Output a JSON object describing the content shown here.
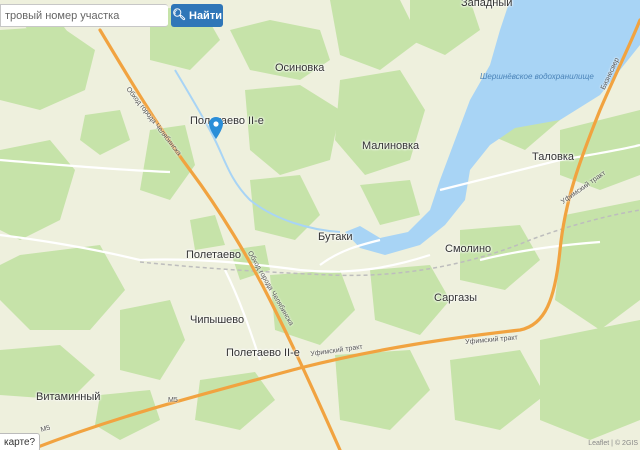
{
  "search": {
    "placeholder": "Кадастровый номер участка",
    "visible_text": "тровый номер участка",
    "button_label": "Найти",
    "button_icon": "search-icon"
  },
  "map_link": {
    "label": "карте?"
  },
  "attribution": {
    "text": "Leaflet | © 2GIS"
  },
  "colors": {
    "background": "#eef0dd",
    "forest": "#c6e3a9",
    "water": "#a8d4f5",
    "highway": "#f1a340",
    "road": "#ffffff",
    "button": "#2f76b8",
    "marker": "#2a8ed8"
  },
  "places": {
    "zapadny": "Западный",
    "osinovka": "Осиновка",
    "poletaevo2_top": "Полетаево II-е",
    "malinovka": "Малиновка",
    "talovka": "Таловка",
    "butaki": "Бутаки",
    "smolino": "Смолино",
    "poletaevo": "Полетаево",
    "sargazy": "Саргазы",
    "chipyshevo": "Чипышево",
    "poletaevo2_bottom": "Полетаево II-е",
    "vitaminny": "Витаминный"
  },
  "water_labels": {
    "reservoir": "Шершнёвское водохранилище"
  },
  "roads": {
    "obkhod_top": "Обход города Челябинска",
    "obkhod_mid": "Обход города Челябинска",
    "ufimsky_bottom": "Уфимский тракт",
    "ufimsky_right_a": "Уфимский тракт",
    "ufimsky_right_b": "Уфимский тракт",
    "m5": "М5",
    "m5_left": "М5",
    "bypass_ne": "Бизнесвер"
  },
  "marker": {
    "icon": "map-pin-icon"
  }
}
